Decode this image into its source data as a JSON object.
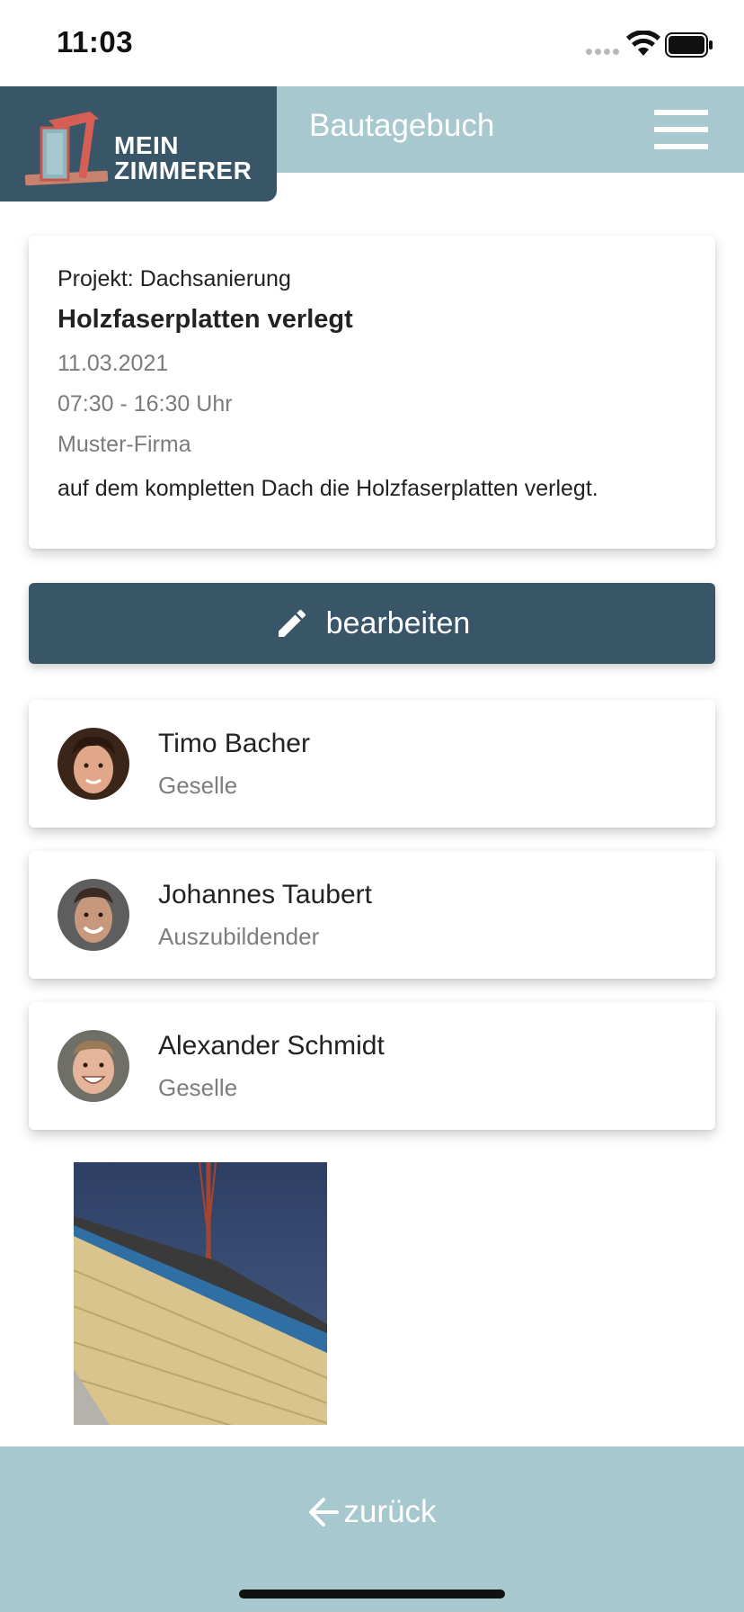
{
  "status_bar": {
    "time": "11:03"
  },
  "header": {
    "brand_line1": "MEIN",
    "brand_line2": "ZIMMERER",
    "title": "Bautagebuch"
  },
  "entry": {
    "project": "Projekt: Dachsanierung",
    "title": "Holzfaserplatten verlegt",
    "date": "11.03.2021",
    "time_range": "07:30 - 16:30 Uhr",
    "company": "Muster-Firma",
    "description": "auf dem kompletten Dach die Holzfaserplatten verlegt."
  },
  "edit_button": {
    "label": "bearbeiten",
    "icon": "pencil-icon"
  },
  "workers": [
    {
      "name": "Timo Bacher",
      "role": "Geselle"
    },
    {
      "name": "Johannes Taubert",
      "role": "Auszubildender"
    },
    {
      "name": "Alexander Schmidt",
      "role": "Geselle"
    }
  ],
  "footer": {
    "back_label": "zurück",
    "icon": "arrow-left-icon"
  },
  "colors": {
    "primary_dark": "#395669",
    "accent_light": "#a8c8cf",
    "muted_text": "#7b7b7b"
  }
}
